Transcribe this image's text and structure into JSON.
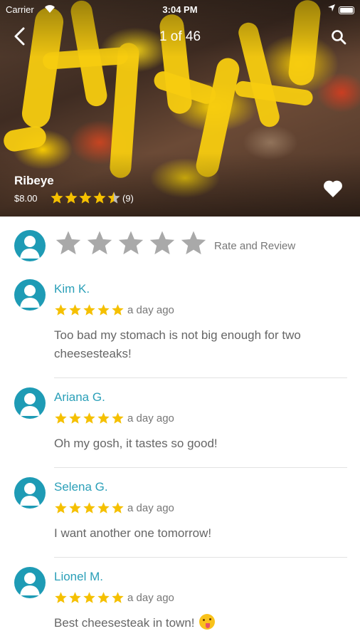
{
  "status_bar": {
    "carrier": "Carrier",
    "time": "3:04 PM"
  },
  "header": {
    "counter": "1 of 46"
  },
  "item": {
    "title": "Ribeye",
    "price": "$8.00",
    "rating": 4.5,
    "review_count": "(9)"
  },
  "rate_prompt": {
    "label": "Rate and Review"
  },
  "reviews": [
    {
      "name": "Kim K.",
      "stars": 5,
      "time": "a day ago",
      "text": "Too bad my stomach is not big enough for two cheesesteaks!"
    },
    {
      "name": "Ariana G.",
      "stars": 5,
      "time": "a day ago",
      "text": "Oh my gosh, it tastes so good!"
    },
    {
      "name": "Selena G.",
      "stars": 5,
      "time": "a day ago",
      "text": "I want another one tomorrow!"
    },
    {
      "name": "Lionel M.",
      "stars": 5,
      "time": "a day ago",
      "text": "Best cheesesteak in town!"
    }
  ],
  "colors": {
    "accent": "#2a9fb8",
    "avatar": "#1e9bb5",
    "star": "#f5c000",
    "star_empty": "#a9a9a9"
  },
  "icons": {
    "back": "chevron-left-icon",
    "search": "search-icon",
    "favorite": "heart-icon",
    "avatar": "user-silhouette-icon",
    "emoji": "face-savoring-food-icon"
  }
}
